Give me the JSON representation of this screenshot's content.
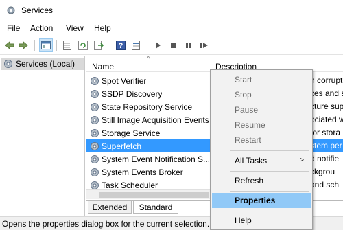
{
  "window": {
    "title": "Services"
  },
  "menubar": {
    "items": [
      "File",
      "Action",
      "View",
      "Help"
    ]
  },
  "tree": {
    "root_label": "Services (Local)"
  },
  "columns": {
    "name": "Name",
    "description": "Description",
    "sort_indicator": "^"
  },
  "services": [
    {
      "name": "Spot Verifier",
      "desc": "n corrupt"
    },
    {
      "name": "SSDP Discovery",
      "desc": "ces and se"
    },
    {
      "name": "State Repository Service",
      "desc": "cture sup"
    },
    {
      "name": "Still Image Acquisition Events",
      "desc": "ociated wi"
    },
    {
      "name": "Storage Service",
      "desc": "for stora"
    },
    {
      "name": "Superfetch",
      "desc": "stem per",
      "selected": true
    },
    {
      "name": "System Event Notification S...",
      "desc": "d notifie"
    },
    {
      "name": "System Events Broker",
      "desc": "ckgrou"
    },
    {
      "name": "Task Scheduler",
      "desc": "and sch"
    }
  ],
  "tabs": {
    "extended": "Extended",
    "standard": "Standard",
    "active": "Standard"
  },
  "status": {
    "text": "Opens the properties dialog box for the current selection."
  },
  "context_menu": {
    "items": [
      {
        "label": "Start",
        "enabled": false
      },
      {
        "label": "Stop",
        "enabled": false
      },
      {
        "label": "Pause",
        "enabled": false
      },
      {
        "label": "Resume",
        "enabled": false
      },
      {
        "label": "Restart",
        "enabled": false
      },
      {
        "label": "All Tasks",
        "submenu": true
      },
      {
        "label": "Refresh"
      },
      {
        "label": "Properties",
        "highlighted": true,
        "bold": true
      },
      {
        "label": "Help"
      }
    ],
    "submenu_arrow": ">"
  },
  "colors": {
    "selection": "#3399ff",
    "menu_highlight": "#91c9f7",
    "menu_bg": "#f2f2f2"
  },
  "icons": [
    "services-app-icon",
    "back-icon",
    "forward-icon",
    "show-hide-tree-icon",
    "export-list-icon",
    "refresh-icon",
    "export-icon",
    "help-icon",
    "properties-pane-icon",
    "start-service-icon",
    "stop-service-icon",
    "pause-service-icon",
    "restart-service-icon",
    "gear-icon"
  ]
}
